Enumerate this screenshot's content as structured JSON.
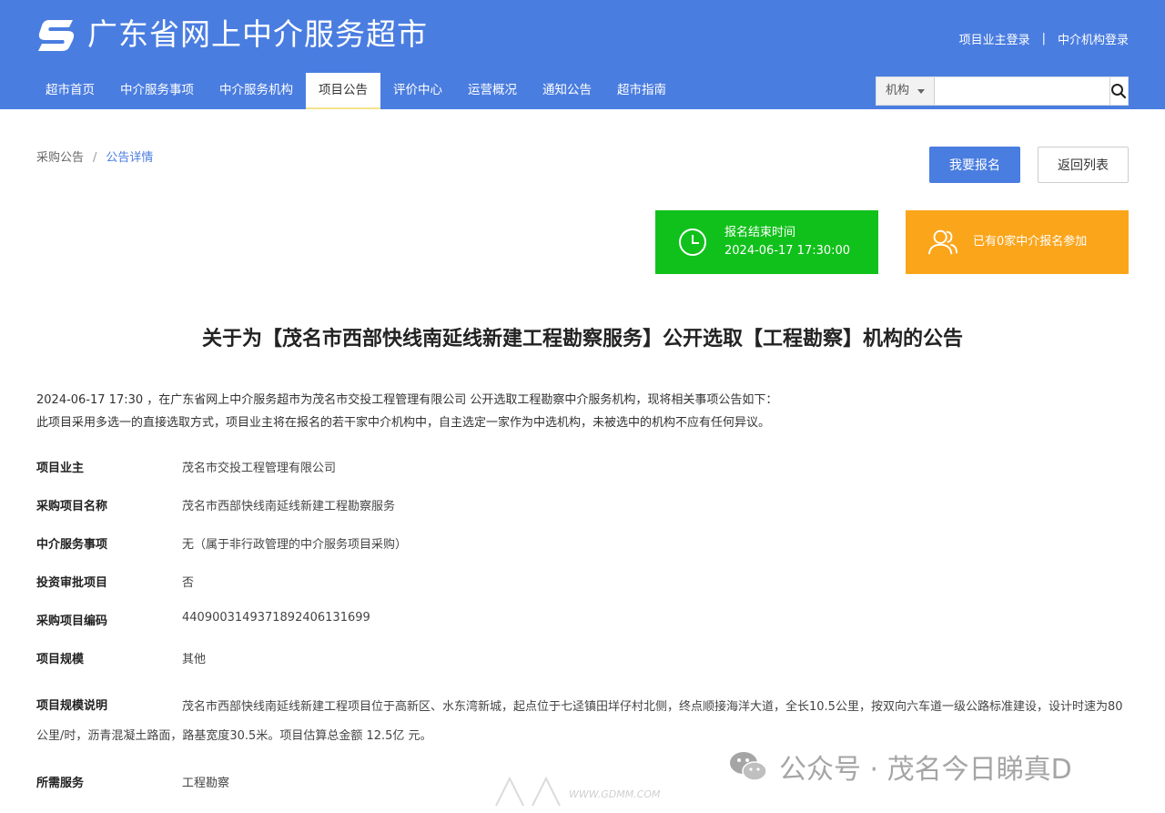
{
  "header": {
    "site_title": "广东省网上中介服务超市",
    "owner_login": "项目业主登录",
    "separator": "|",
    "agency_login": "中介机构登录"
  },
  "nav": {
    "items": [
      {
        "label": "超市首页"
      },
      {
        "label": "中介服务事项"
      },
      {
        "label": "中介服务机构"
      },
      {
        "label": "项目公告",
        "active": true
      },
      {
        "label": "评价中心"
      },
      {
        "label": "运营概况"
      },
      {
        "label": "通知公告"
      },
      {
        "label": "超市指南"
      }
    ]
  },
  "search": {
    "select_value": "机构",
    "input_value": "",
    "button_icon": "search-icon"
  },
  "breadcrumb": {
    "parent": "采购公告",
    "separator": "/",
    "current": "公告详情"
  },
  "actions": {
    "register_label": "我要报名",
    "back_label": "返回列表"
  },
  "cards": {
    "deadline_label": "报名结束时间",
    "deadline_value": "2024-06-17 17:30:00",
    "participants_text": "已有0家中介报名参加",
    "deadline_color": "#11c11b",
    "participants_color": "#fba51b"
  },
  "notice": {
    "title": "关于为【茂名市西部快线南延线新建工程勘察服务】公开选取【工程勘察】机构的公告",
    "intro_line1": "2024-06-17 17:30 ，在广东省网上中介服务超市为茂名市交投工程管理有限公司 公开选取工程勘察中介服务机构，现将相关事项公告如下：",
    "intro_line2": "此项目采用多选一的直接选取方式，项目业主将在报名的若干家中介机构中，自主选定一家作为中选机构，未被选中的机构不应有任何异议。"
  },
  "info": {
    "owner": {
      "label": "项目业主",
      "value": "茂名市交投工程管理有限公司"
    },
    "project_name": {
      "label": "采购项目名称",
      "value": "茂名市西部快线南延线新建工程勘察服务"
    },
    "service_item": {
      "label": "中介服务事项",
      "value": "无（属于非行政管理的中介服务项目采购）"
    },
    "investment_approval": {
      "label": "投资审批项目",
      "value": "否"
    },
    "project_code": {
      "label": "采购项目编码",
      "value": "440900314937189240613169​9"
    },
    "scale": {
      "label": "项目规模",
      "value": "其他"
    },
    "scale_desc": {
      "label": "项目规模说明",
      "value": "茂名市西部快线南延线新建工程项目位于高新区、水东湾新城，起点位于七迳镇田垟仔村北侧，终点顺接海洋大道，全长10.5公里，按双向六车道一级公路标准建设，设计时速为80公里/时，沥青混凝土路面，路基宽度30.5米。项目估算总金额 12.5亿 元。"
    },
    "required_service": {
      "label": "所需服务",
      "value": "工程勘察"
    }
  },
  "watermark": {
    "wechat_text": "公众号 · 茂名今日睇真D",
    "site_text": "WWW.GDMM.COM"
  },
  "colors": {
    "header_bg": "#4a7de0",
    "primary": "#4a7de0"
  }
}
